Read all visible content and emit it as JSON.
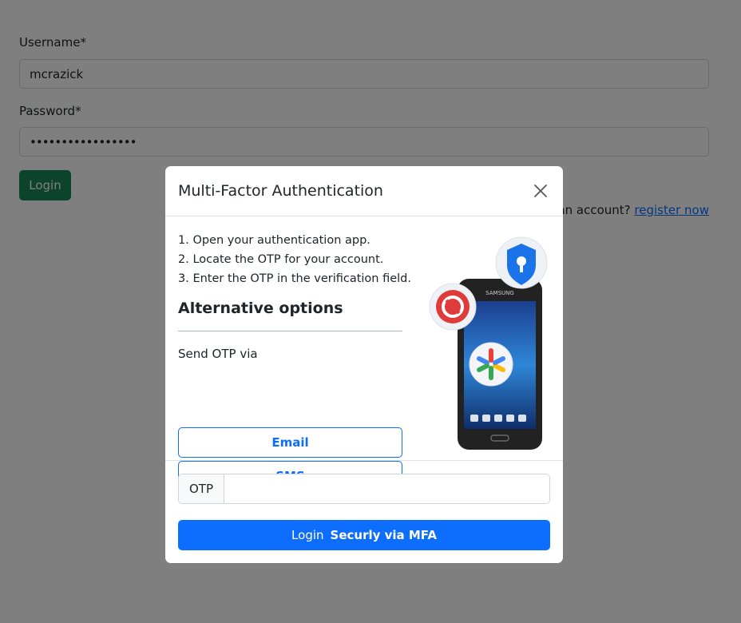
{
  "form": {
    "username_label": "Username*",
    "username_value": "mcrazick",
    "password_label": "Password*",
    "password_value": "•••••••••••••••••",
    "login_label": "Login",
    "register_prefix": "Don't have an account? ",
    "register_link": "register now"
  },
  "modal": {
    "title": "Multi-Factor Authentication",
    "steps": [
      "1. Open your authentication app.",
      "2. Locate the OTP for your account.",
      "3. Enter the OTP in the verification field."
    ],
    "alt_title": "Alternative options",
    "send_via": "Send OTP via",
    "email_label": "Email",
    "sms_label": "SMS",
    "otp_label": "OTP",
    "otp_value": "",
    "submit_prefix": "Login",
    "submit_strong": "Securly via MFA",
    "phone_brand": "SAMSUNG"
  },
  "colors": {
    "primary": "#0d6efd",
    "success": "#198754",
    "backdrop": "rgba(0,0,0,0.5)"
  },
  "icons": {
    "close": "close-icon",
    "lock_shield": "lock-shield-icon",
    "authy": "authy-icon",
    "google_authenticator": "google-authenticator-icon"
  }
}
